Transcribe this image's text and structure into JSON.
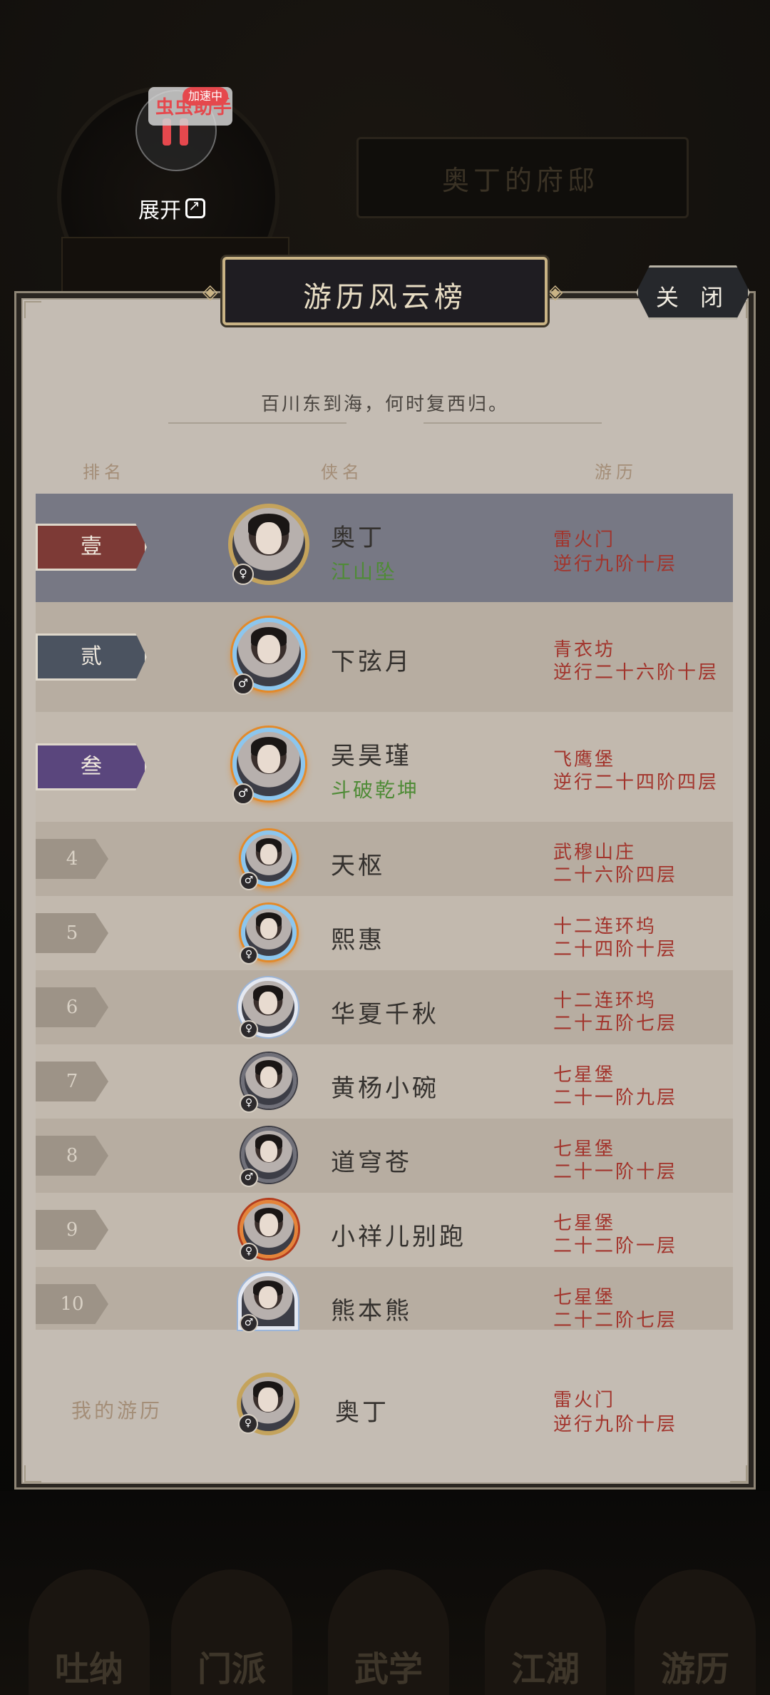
{
  "recorder": {
    "badge_text": "虫虫助手",
    "status_pill": "加速中",
    "expand_label": "展开"
  },
  "background": {
    "mansion_title": "奥丁的府邸",
    "bottom_tabs": [
      "吐纳",
      "门派",
      "武学",
      "江湖",
      "游历"
    ]
  },
  "panel": {
    "title": "游历风云榜",
    "close_label": "关 闭",
    "motto": "百川东到海，何时复西归。",
    "columns": {
      "rank": "排名",
      "name": "侠名",
      "progress": "游历"
    }
  },
  "leaderboard": [
    {
      "rank_label": "壹",
      "name": "奥丁",
      "title": "江山坠",
      "gender": "♀",
      "sect": "雷火门",
      "progress": "逆行九阶十层"
    },
    {
      "rank_label": "贰",
      "name": "下弦月",
      "title": "",
      "gender": "♂",
      "sect": "青衣坊",
      "progress": "逆行二十六阶十层"
    },
    {
      "rank_label": "叁",
      "name": "吴昊瑾",
      "title": "斗破乾坤",
      "gender": "♂",
      "sect": "飞鹰堡",
      "progress": "逆行二十四阶四层"
    },
    {
      "rank_label": "4",
      "name": "天枢",
      "title": "",
      "gender": "♂",
      "sect": "武穆山庄",
      "progress": "二十六阶四层"
    },
    {
      "rank_label": "5",
      "name": "熙惠",
      "title": "",
      "gender": "♀",
      "sect": "十二连环坞",
      "progress": "二十四阶十层"
    },
    {
      "rank_label": "6",
      "name": "华夏千秋",
      "title": "",
      "gender": "♀",
      "sect": "十二连环坞",
      "progress": "二十五阶七层"
    },
    {
      "rank_label": "7",
      "name": "黄杨小碗",
      "title": "",
      "gender": "♀",
      "sect": "七星堡",
      "progress": "二十一阶九层"
    },
    {
      "rank_label": "8",
      "name": "道穹苍",
      "title": "",
      "gender": "♂",
      "sect": "七星堡",
      "progress": "二十一阶十层"
    },
    {
      "rank_label": "9",
      "name": "小祥儿别跑",
      "title": "",
      "gender": "♀",
      "sect": "七星堡",
      "progress": "二十二阶一层"
    },
    {
      "rank_label": "10",
      "name": "熊本熊",
      "title": "",
      "gender": "♂",
      "sect": "七星堡",
      "progress": "二十二阶七层"
    }
  ],
  "my_record": {
    "label": "我的游历",
    "name": "奥丁",
    "gender": "♀",
    "sect": "雷火门",
    "progress": "逆行九阶十层"
  }
}
